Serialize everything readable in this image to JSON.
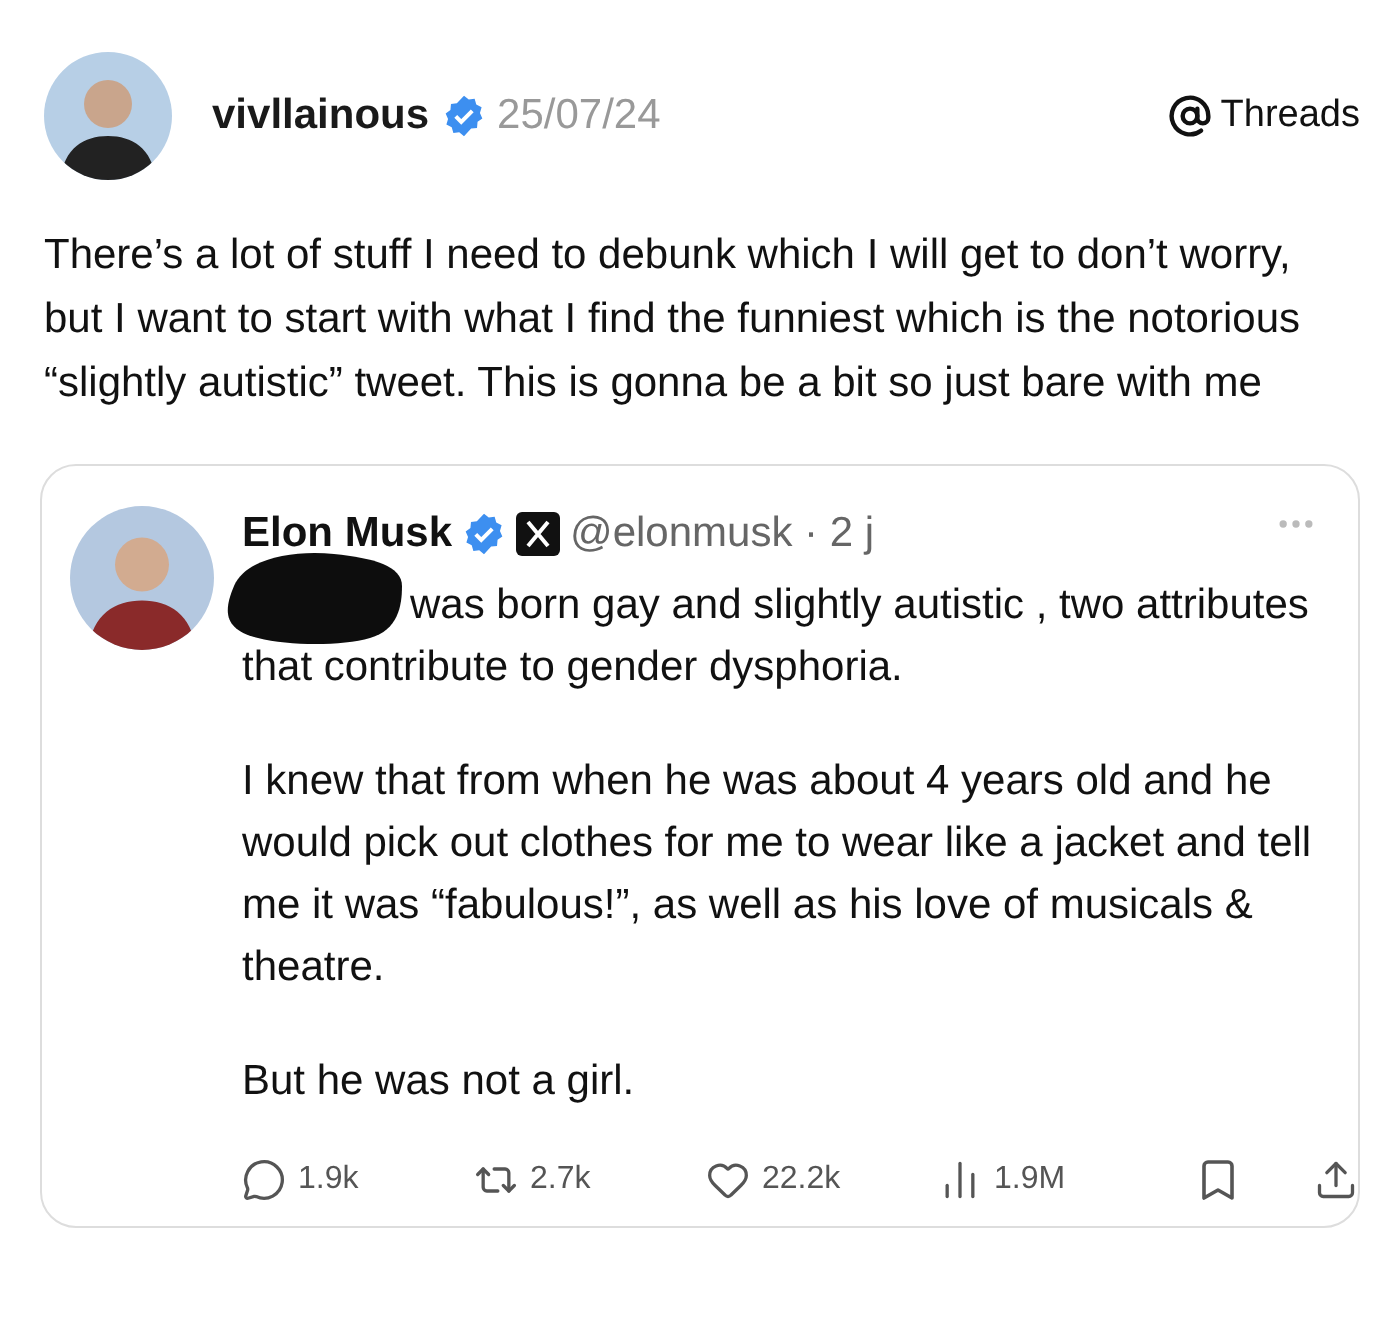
{
  "post": {
    "author": {
      "name": "vivllainous",
      "verified": true,
      "date": "25/07/24"
    },
    "brand": "Threads",
    "text": "There’s a lot of stuff I need to debunk which I will get to don’t worry, but I want to start with what I find the funniest which is the notorious “slightly autistic” tweet. This is gonna be a bit so just bare with me",
    "quoted_tweet": {
      "author": {
        "name": "Elon Musk",
        "verified": true,
        "handle_line": "@elonmusk · 2 j"
      },
      "paragraphs": [
        {
          "text": "was born gay and slightly autistic , two attributes that contribute to gender dysphoria.",
          "redacted_start": true
        },
        {
          "text": "I knew that from when he was about 4 years old and he would pick out clothes for me to wear like a jacket and tell me it was “fabulous!”, as well as his love of musicals & theatre.",
          "redacted_start": false
        },
        {
          "text": "But he was not a girl.",
          "redacted_start": false
        }
      ],
      "stats": [
        {
          "kind": "reply",
          "count": "1.9k"
        },
        {
          "kind": "repost",
          "count": "2.7k"
        },
        {
          "kind": "like",
          "count": "22.2k"
        },
        {
          "kind": "views",
          "count": "1.9M"
        }
      ]
    }
  }
}
